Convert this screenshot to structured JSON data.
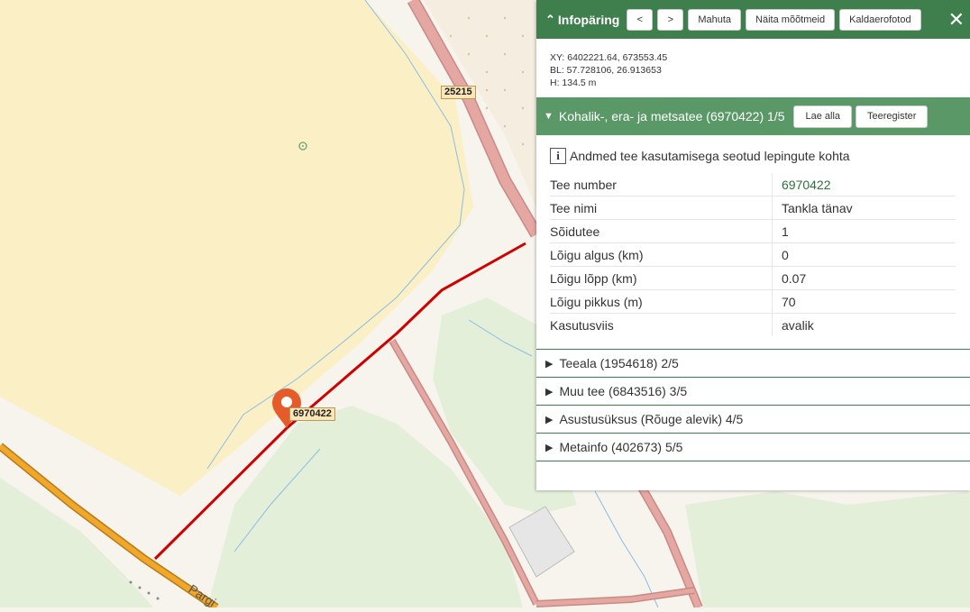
{
  "map": {
    "road_labels": [
      "25215",
      "6970422"
    ],
    "street_label": "Pargi",
    "colors": {
      "field": "#fbefc6",
      "park": "#e4efda",
      "road_pink": "#e5a7a2",
      "road_orange": "#f0a72a",
      "highlight": "#d10000",
      "marker": "#e55b2a",
      "water": "#8cbde4"
    }
  },
  "panel": {
    "title": "Infopäring",
    "buttons": {
      "prev": "<",
      "next": ">",
      "fit": "Mahuta",
      "show_measurements": "Näita mõõtmeid",
      "aerial_photos": "Kaldaerofotod"
    },
    "close_icon": "close-icon",
    "coords": {
      "xy": "XY: 6402221.64, 673553.45",
      "bl": "BL: 57.728106, 26.913653",
      "h": "H: 134.5 m"
    },
    "open_section": {
      "title": "Kohalik-, era- ja metsatee (6970422) 1/5",
      "download_label": "Lae alla",
      "registry_label": "Teeregister"
    },
    "info_text": "Andmed tee kasutamisega seotud lepingute kohta",
    "attributes": [
      {
        "key": "Tee number",
        "value": "6970422"
      },
      {
        "key": "Tee nimi",
        "value": "Tankla tänav"
      },
      {
        "key": "Sõidutee",
        "value": "1"
      },
      {
        "key": "Lõigu algus (km)",
        "value": "0"
      },
      {
        "key": "Lõigu lõpp (km)",
        "value": "0.07"
      },
      {
        "key": "Lõigu pikkus (m)",
        "value": "70"
      },
      {
        "key": "Kasutusviis",
        "value": "avalik"
      }
    ],
    "sections": [
      "Teeala (1954618) 2/5",
      "Muu tee (6843516) 3/5",
      "Asustusüksus (Rõuge alevik) 4/5",
      "Metainfo (402673) 5/5"
    ]
  }
}
